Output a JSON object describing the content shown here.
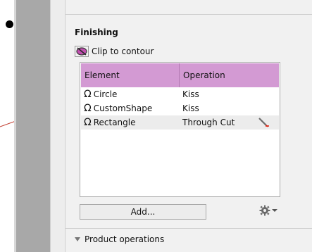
{
  "finishing": {
    "title": "Finishing",
    "clip_label": "Clip to contour",
    "columns": [
      "Element",
      "Operation"
    ],
    "rows": [
      {
        "element": "Circle",
        "operation": "Kiss"
      },
      {
        "element": "CustomShape",
        "operation": "Kiss"
      },
      {
        "element": "Rectangle",
        "operation": "Through Cut"
      }
    ],
    "add_label": "Add...",
    "icons": {
      "element_row": "omega-icon",
      "clip": "clip-contour-icon",
      "operation_edit": "knife-icon",
      "menu": "gear-icon",
      "menu_caret": "caret-down-icon",
      "collapse": "triangle-down-icon"
    },
    "colors": {
      "header": "#d39ad3",
      "guide_line": "#c0392b"
    }
  },
  "footer": {
    "product_operations_label": "Product operations"
  }
}
